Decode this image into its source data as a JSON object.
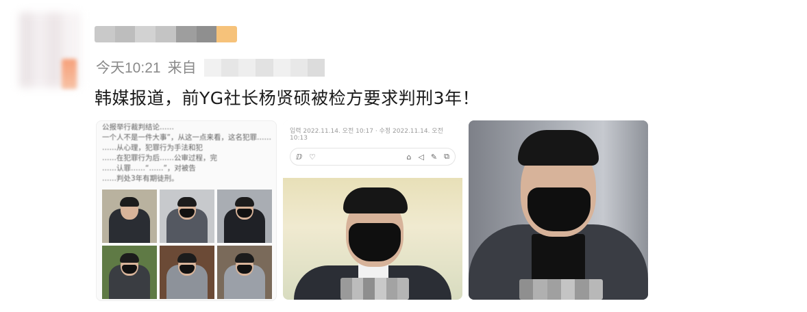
{
  "post": {
    "time": "今天10:21",
    "source_prefix": "来自",
    "text": "韩媒报道，前YG社长杨贤硕被检方要求判刑3年！"
  },
  "images": {
    "news_excerpt": [
      "公报举行裁判结论……",
      "一个人不是一件大事”，从这一点来看，这名犯罪……",
      "……从心理，犯罪行为手法和犯",
      "……在犯罪行为后……公审过程，完",
      "……认罪……“……”，对被告",
      "……判处3年有期徒刑。"
    ],
    "article_timestamp": "입력 2022.11.14. 오전 10:17 · 수정 2022.11.14. 오전 10:13"
  }
}
